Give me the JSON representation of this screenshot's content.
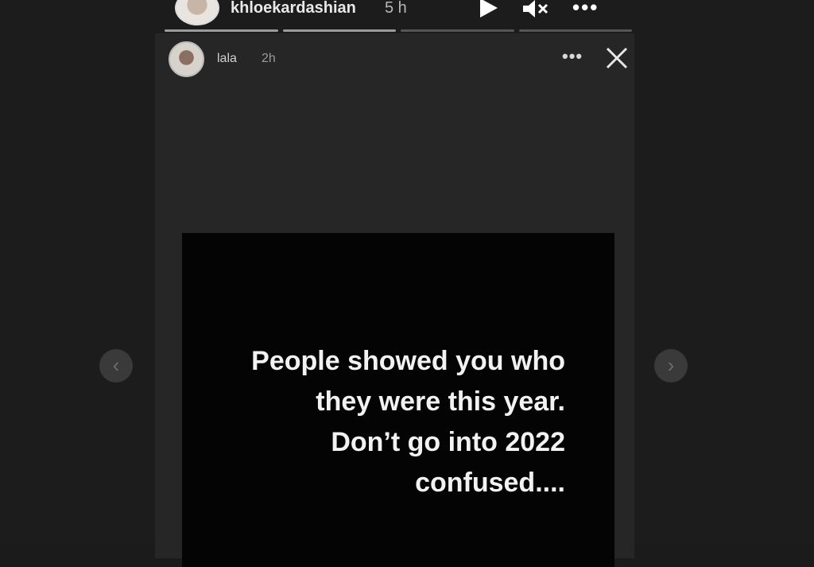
{
  "outer_story": {
    "username": "khloekardashian",
    "time": "5 h",
    "icons": {
      "play": "play-icon",
      "mute": "mute-icon",
      "more": "more-icon"
    },
    "more_label": "•••"
  },
  "inner_story": {
    "username": "lala",
    "time": "2h",
    "more_label": "•••",
    "quote_lines": [
      "People showed you who",
      "they were this year.",
      "Don’t go into 2022",
      "confused...."
    ]
  },
  "navigation": {
    "prev_label": "‹",
    "next_label": "›"
  },
  "colors": {
    "background": "#1c1c1c",
    "card": "#262626",
    "quote_box": "#040404",
    "text": "#f2f2f2"
  }
}
